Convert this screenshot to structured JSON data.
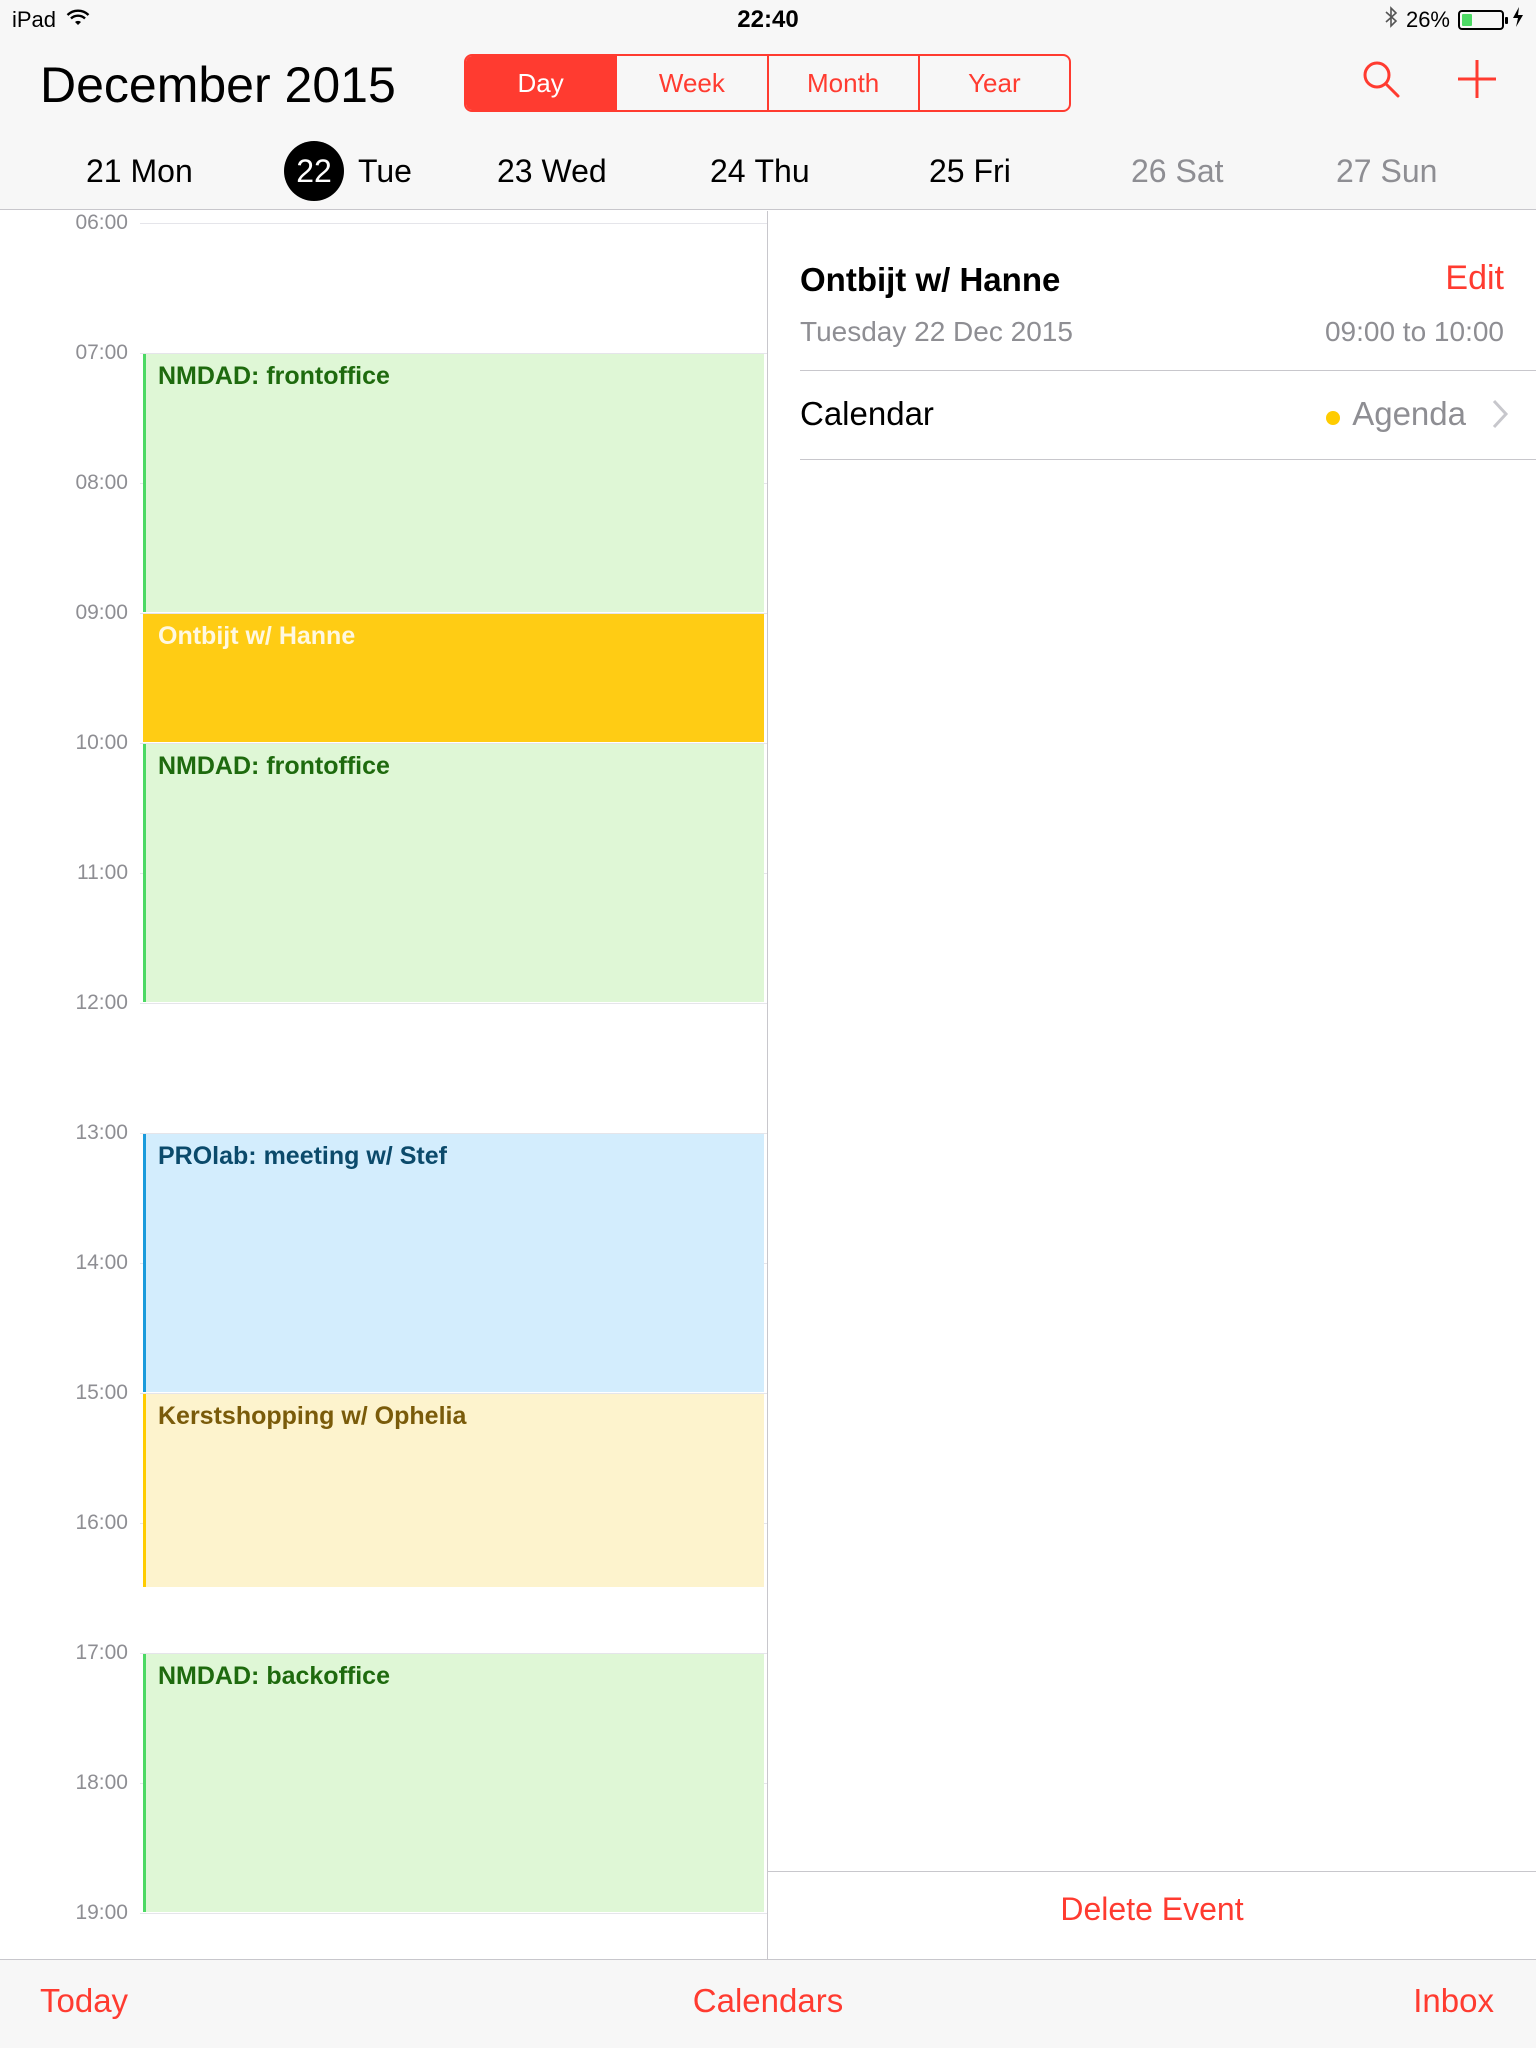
{
  "status_bar": {
    "device": "iPad",
    "time": "22:40",
    "battery": "26%",
    "battery_level": 0.26
  },
  "header": {
    "month": "December",
    "year": "2015",
    "view_tabs": [
      {
        "label": "Day",
        "active": true
      },
      {
        "label": "Week",
        "active": false
      },
      {
        "label": "Month",
        "active": false
      },
      {
        "label": "Year",
        "active": false
      }
    ],
    "icons": [
      "search-icon",
      "add-icon"
    ],
    "accent_color": "#ff3b30"
  },
  "week_days": [
    {
      "num": "21",
      "name": "Mon",
      "selected": false,
      "weekend": false
    },
    {
      "num": "22",
      "name": "Tue",
      "selected": true,
      "weekend": false
    },
    {
      "num": "23",
      "name": "Wed",
      "selected": false,
      "weekend": false
    },
    {
      "num": "24",
      "name": "Thu",
      "selected": false,
      "weekend": false
    },
    {
      "num": "25",
      "name": "Fri",
      "selected": false,
      "weekend": false
    },
    {
      "num": "26",
      "name": "Sat",
      "selected": false,
      "weekend": true
    },
    {
      "num": "27",
      "name": "Sun",
      "selected": false,
      "weekend": true
    }
  ],
  "timeline": {
    "hours": [
      "06:00",
      "07:00",
      "08:00",
      "09:00",
      "10:00",
      "11:00",
      "12:00",
      "13:00",
      "14:00",
      "15:00",
      "16:00",
      "17:00",
      "18:00",
      "19:00"
    ],
    "events": [
      {
        "title": "NMDAD: frontoffice",
        "start": "07:00",
        "end": "09:00",
        "color": "green"
      },
      {
        "title": "Ontbijt w/ Hanne",
        "start": "09:00",
        "end": "10:00",
        "color": "yellow"
      },
      {
        "title": "NMDAD: frontoffice",
        "start": "10:00",
        "end": "12:00",
        "color": "green"
      },
      {
        "title": "PROlab: meeting w/ Stef",
        "start": "13:00",
        "end": "15:00",
        "color": "blue"
      },
      {
        "title": "Kerstshopping w/ Ophelia",
        "start": "15:00",
        "end": "16:30",
        "color": "cream"
      },
      {
        "title": "NMDAD: backoffice",
        "start": "17:00",
        "end": "19:00",
        "color": "green"
      }
    ]
  },
  "detail": {
    "title": "Ontbijt w/ Hanne",
    "edit_label": "Edit",
    "date": "Tuesday 22 Dec 2015",
    "time_range": "09:00 to 10:00",
    "calendar_label": "Calendar",
    "calendar_value": "Agenda",
    "calendar_color": "#ffcc00",
    "delete_label": "Delete Event"
  },
  "tab_bar": {
    "today": "Today",
    "calendars": "Calendars",
    "inbox": "Inbox"
  }
}
